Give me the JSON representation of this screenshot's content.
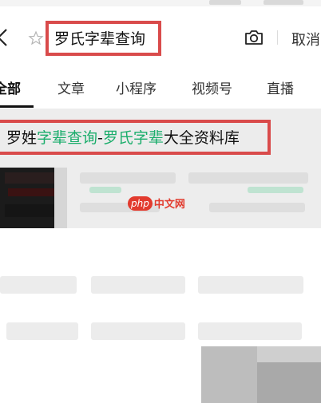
{
  "search": {
    "query": "罗氏字辈查询",
    "cancel_label": "取消"
  },
  "tabs": [
    {
      "label": "全部"
    },
    {
      "label": "文章"
    },
    {
      "label": "小程序"
    },
    {
      "label": "视频号"
    },
    {
      "label": "直播"
    }
  ],
  "result": {
    "title_parts": [
      "罗姓",
      "字辈查询",
      "-",
      "罗氏字辈",
      "大全资料库"
    ]
  },
  "watermark": {
    "badge": "php",
    "text": "中文网"
  },
  "colors": {
    "highlight_box": "#d94b4b",
    "keyword": "#1aad6b",
    "watermark": "#e23b2e"
  },
  "icons": [
    "back-icon",
    "star-icon",
    "camera-icon"
  ]
}
